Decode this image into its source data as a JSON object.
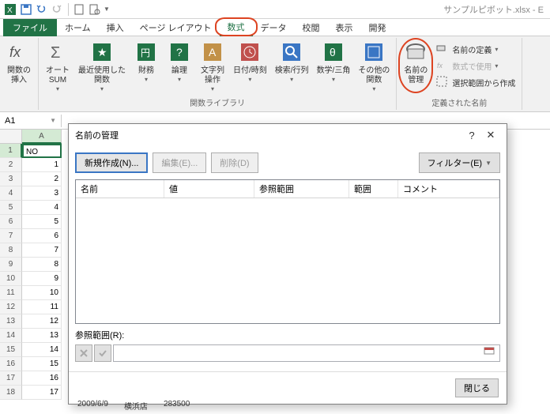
{
  "title": "サンプルピボット.xlsx - E",
  "tabs": {
    "file": "ファイル",
    "list": [
      "ホーム",
      "挿入",
      "ページ レイアウト",
      "数式",
      "データ",
      "校閲",
      "表示",
      "開発"
    ],
    "active_index": 3
  },
  "ribbon": {
    "fx": {
      "label": "関数の\n挿入"
    },
    "lib_group_label": "関数ライブラリ",
    "lib": [
      "オート\nSUM",
      "最近使用した\n関数",
      "財務",
      "論理",
      "文字列\n操作",
      "日付/時刻",
      "検索/行列",
      "数学/三角",
      "その他の\n関数"
    ],
    "name_mgr": "名前の\n管理",
    "defined": {
      "define": "名前の定義",
      "use": "数式で使用",
      "create": "選択範囲から作成",
      "group_label": "定義された名前"
    }
  },
  "name_box": "A1",
  "grid": {
    "col_a": "A",
    "cell_a1": "NO",
    "rows": [
      "1",
      "2",
      "3",
      "4",
      "5",
      "6",
      "7",
      "8",
      "9",
      "10",
      "11",
      "12",
      "13",
      "14",
      "15",
      "16",
      "17"
    ],
    "row_nums": [
      "1",
      "2",
      "3",
      "4",
      "5",
      "6",
      "7",
      "8",
      "9",
      "10",
      "11",
      "12",
      "13",
      "14",
      "15",
      "16",
      "17",
      "18"
    ]
  },
  "dialog": {
    "title": "名前の管理",
    "new": "新規作成(N)...",
    "edit": "編集(E)...",
    "delete": "削除(D)",
    "filter": "フィルター(E)",
    "cols": {
      "name": "名前",
      "value": "値",
      "ref": "参照範囲",
      "scope": "範囲",
      "comment": "コメント"
    },
    "ref_label": "参照範囲(R):",
    "close": "閉じる"
  },
  "bottom": {
    "date": "2009/6/9",
    "store": "横浜店",
    "amount": "283500"
  }
}
